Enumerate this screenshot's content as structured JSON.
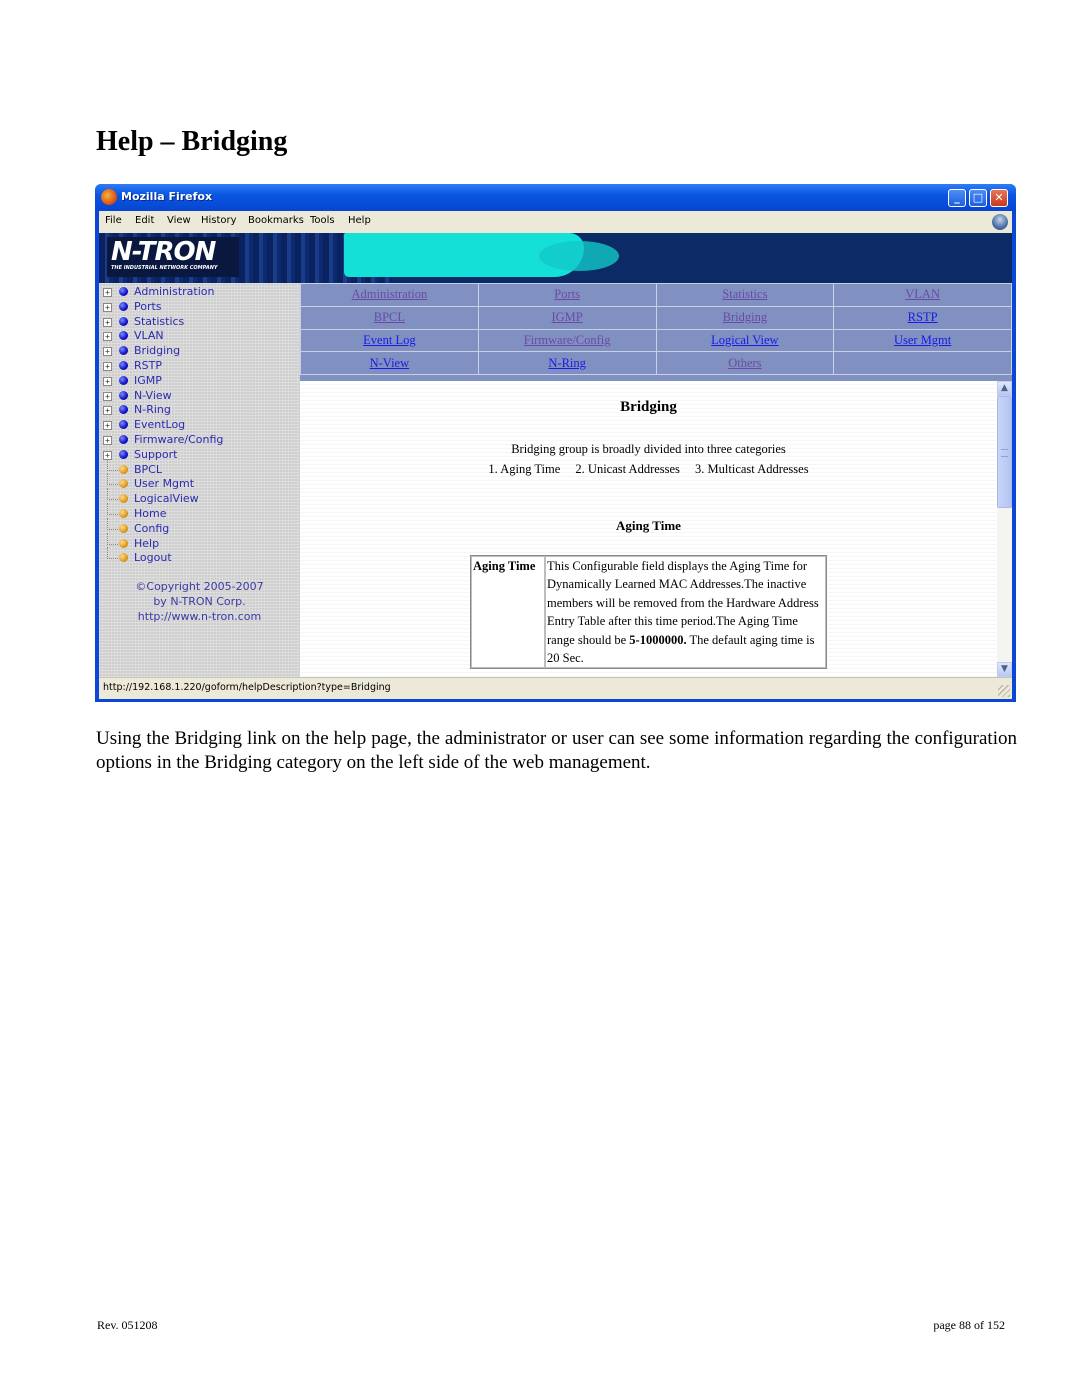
{
  "document": {
    "title": "Help – Bridging",
    "paragraph": "Using the Bridging link on the help page, the administrator or user can see some information regarding the configuration options in the Bridging category on the left side of the web management.",
    "footer": {
      "revision": "Rev.  051208",
      "page": "page 88 of 152"
    }
  },
  "browser": {
    "window_title": "Mozilla Firefox",
    "window_buttons": {
      "minimize": "_",
      "maximize": "□",
      "close": "✕"
    },
    "menu": [
      "File",
      "Edit",
      "View",
      "History",
      "Bookmarks",
      "Tools",
      "Help"
    ],
    "status_url": "http://192.168.1.220/goform/helpDescription?type=Bridging"
  },
  "banner": {
    "logo": "N-TRON",
    "tagline": "THE INDUSTRIAL NETWORK COMPANY"
  },
  "sidebar": {
    "items": [
      {
        "label": "Administration",
        "type": "folder"
      },
      {
        "label": "Ports",
        "type": "folder"
      },
      {
        "label": "Statistics",
        "type": "folder"
      },
      {
        "label": "VLAN",
        "type": "folder"
      },
      {
        "label": "Bridging",
        "type": "folder"
      },
      {
        "label": "RSTP",
        "type": "folder"
      },
      {
        "label": "IGMP",
        "type": "folder"
      },
      {
        "label": "N-View",
        "type": "folder"
      },
      {
        "label": "N-Ring",
        "type": "folder"
      },
      {
        "label": "EventLog",
        "type": "folder"
      },
      {
        "label": "Firmware/Config",
        "type": "folder"
      },
      {
        "label": "Support",
        "type": "folder"
      },
      {
        "label": "BPCL",
        "type": "page"
      },
      {
        "label": "User Mgmt",
        "type": "page"
      },
      {
        "label": "LogicalView",
        "type": "page"
      },
      {
        "label": "Home",
        "type": "page"
      },
      {
        "label": "Config",
        "type": "page"
      },
      {
        "label": "Help",
        "type": "page"
      },
      {
        "label": "Logout",
        "type": "page"
      }
    ],
    "copyright": [
      "©Copyright 2005-2007",
      "by N-TRON Corp.",
      "http://www.n-tron.com"
    ]
  },
  "help_nav": {
    "rows": [
      [
        {
          "label": "Administration",
          "visited": true
        },
        {
          "label": "Ports",
          "visited": true
        },
        {
          "label": "Statistics",
          "visited": true
        },
        {
          "label": "VLAN",
          "visited": true
        }
      ],
      [
        {
          "label": "BPCL",
          "visited": true
        },
        {
          "label": "IGMP",
          "visited": true
        },
        {
          "label": "Bridging",
          "visited": true
        },
        {
          "label": "RSTP",
          "visited": false
        }
      ],
      [
        {
          "label": "Event Log",
          "visited": false
        },
        {
          "label": "Firmware/Config",
          "visited": true
        },
        {
          "label": "Logical View",
          "visited": false
        },
        {
          "label": "User Mgmt",
          "visited": false
        }
      ],
      [
        {
          "label": "N-View",
          "visited": false
        },
        {
          "label": "N-Ring",
          "visited": false
        },
        {
          "label": "Others",
          "visited": true
        },
        {
          "label": "",
          "visited": false
        }
      ]
    ]
  },
  "content": {
    "heading": "Bridging",
    "intro": "Bridging group is broadly divided into three categories",
    "categories": [
      "1. Aging Time",
      "2. Unicast Addresses",
      "3. Multicast Addresses"
    ],
    "section_heading": "Aging Time",
    "table": {
      "term": "Aging Time",
      "description_text": "This Configurable field displays the Aging Time for Dynamically Learned MAC Addresses.The inactive members will be removed from the Hardware Address Entry Table after this time period.The Aging Time range should be ",
      "range_bold": "5-1000000.",
      "description_tail": " The default aging time is 20 Sec."
    }
  },
  "colors": {
    "titlebar": "#0a56e0",
    "nav_bg": "#8090c0",
    "visited_link": "#6a4aa8",
    "link": "#1a1ae8",
    "sidebar_text": "#2a2ab0"
  }
}
